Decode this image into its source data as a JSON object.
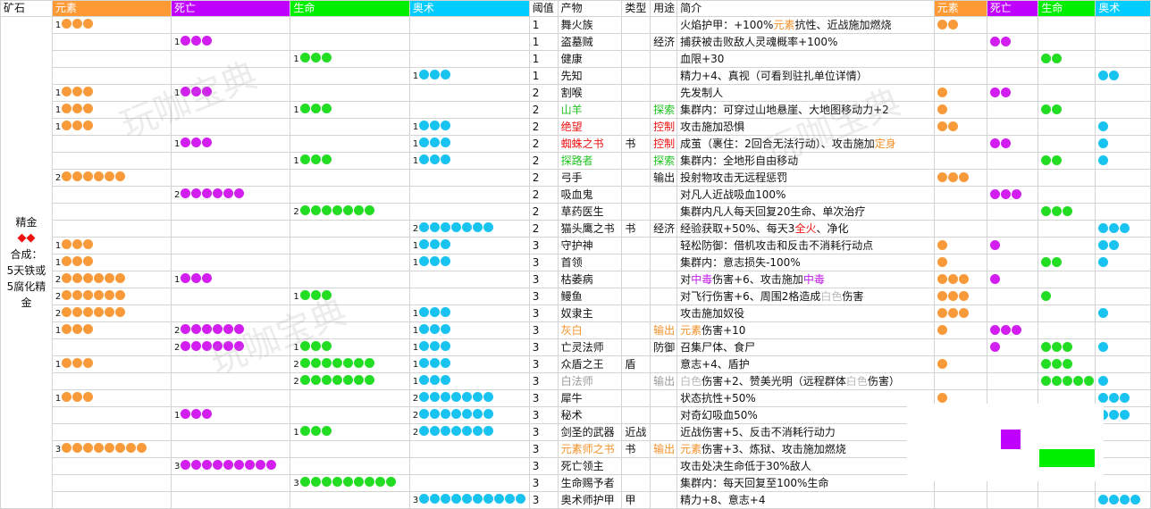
{
  "headers": {
    "ore": "矿石",
    "elem": "元素",
    "death": "死亡",
    "life": "生命",
    "arcane": "奥术",
    "threshold": "阈值",
    "product": "产物",
    "type": "类型",
    "use": "用途",
    "desc": "简介",
    "elem2": "元素",
    "death2": "死亡",
    "life2": "生命",
    "arcane2": "奥术"
  },
  "colors": {
    "elem": "#f99a3a",
    "death": "#d21ff0",
    "life": "#22dd22",
    "arcane": "#19c3f0",
    "elem_header_bg": "#ff9933",
    "death_header_bg": "#c000ff",
    "life_header_bg": "#00ee00",
    "arcane_header_bg": "#00ccff"
  },
  "ore": {
    "name": "精金",
    "diamonds": "◆◆",
    "recipe_label": "合成：",
    "recipe_1": "5天铁或",
    "recipe_2": "5腐化精",
    "recipe_3": "金"
  },
  "watermarks": [
    "玩咖宝典",
    "玩咖宝典",
    "玩咖宝典"
  ],
  "rows": [
    {
      "elem": 1,
      "death": 0,
      "life": 0,
      "arcane": 0,
      "threshold": "1",
      "product": "舞火族",
      "type": "",
      "use": "",
      "desc": [
        {
          "t": "火焰护甲：+100%"
        },
        {
          "t": "元素",
          "c": "t-orange"
        },
        {
          "t": "抗性、近战施加燃烧"
        }
      ],
      "r": [
        2,
        0,
        0,
        0
      ]
    },
    {
      "elem": 0,
      "death": 1,
      "life": 0,
      "arcane": 0,
      "threshold": "1",
      "product": "盗墓贼",
      "type": "",
      "use": "经济",
      "desc": [
        {
          "t": "捕获被击败敌人灵魂概率+100%"
        }
      ],
      "r": [
        0,
        2,
        0,
        0
      ]
    },
    {
      "elem": 0,
      "death": 0,
      "life": 1,
      "arcane": 0,
      "threshold": "1",
      "product": "健康",
      "type": "",
      "use": "",
      "desc": [
        {
          "t": "血限+30"
        }
      ],
      "r": [
        0,
        0,
        2,
        0
      ]
    },
    {
      "elem": 0,
      "death": 0,
      "life": 0,
      "arcane": 1,
      "threshold": "1",
      "product": "先知",
      "type": "",
      "use": "",
      "desc": [
        {
          "t": "精力+4、真视（可看到驻扎单位详情）"
        }
      ],
      "r": [
        0,
        0,
        0,
        2
      ]
    },
    {
      "elem": 1,
      "death": 1,
      "life": 0,
      "arcane": 0,
      "threshold": "2",
      "product": "割喉",
      "type": "",
      "use": "",
      "desc": [
        {
          "t": "先发制人"
        }
      ],
      "r": [
        1,
        2,
        0,
        0
      ]
    },
    {
      "elem": 1,
      "death": 0,
      "life": 1,
      "arcane": 0,
      "threshold": "2",
      "product": "山羊",
      "pc": "t-green",
      "type": "",
      "use": "探索",
      "uc": "t-green",
      "desc": [
        {
          "t": "集群内：可穿过山地悬崖、大地图移动力+2"
        }
      ],
      "r": [
        1,
        0,
        2,
        0
      ]
    },
    {
      "elem": 1,
      "death": 0,
      "life": 0,
      "arcane": 1,
      "threshold": "2",
      "product": "绝望",
      "pc": "t-red",
      "type": "",
      "use": "控制",
      "uc": "t-red",
      "desc": [
        {
          "t": "攻击施加恐惧"
        }
      ],
      "r": [
        2,
        0,
        0,
        1
      ]
    },
    {
      "elem": 0,
      "death": 1,
      "life": 0,
      "arcane": 1,
      "threshold": "2",
      "product": "蜘蛛之书",
      "pc": "t-red",
      "type": "书",
      "use": "控制",
      "uc": "t-red",
      "desc": [
        {
          "t": "成茧（裹住：2回合无法行动）、攻击施加"
        },
        {
          "t": "定身",
          "c": "t-orange"
        }
      ],
      "r": [
        0,
        2,
        0,
        1
      ]
    },
    {
      "elem": 0,
      "death": 0,
      "life": 1,
      "arcane": 1,
      "threshold": "2",
      "product": "探路者",
      "pc": "t-green",
      "type": "",
      "use": "探索",
      "uc": "t-green",
      "desc": [
        {
          "t": "集群内：全地形自由移动"
        }
      ],
      "r": [
        0,
        0,
        2,
        1
      ]
    },
    {
      "elem": 2,
      "death": 0,
      "life": 0,
      "arcane": 0,
      "threshold": "2",
      "product": "弓手",
      "type": "",
      "use": "输出",
      "desc": [
        {
          "t": "投射物攻击无远程惩罚"
        }
      ],
      "r": [
        3,
        0,
        0,
        0
      ]
    },
    {
      "elem": 0,
      "death": 2,
      "life": 0,
      "arcane": 0,
      "threshold": "2",
      "product": "吸血鬼",
      "type": "",
      "use": "",
      "desc": [
        {
          "t": "对凡人近战吸血100%"
        }
      ],
      "r": [
        0,
        3,
        0,
        0
      ]
    },
    {
      "elem": 0,
      "death": 0,
      "life": 2,
      "arcane": 0,
      "threshold": "2",
      "product": "草药医生",
      "type": "",
      "use": "",
      "desc": [
        {
          "t": "集群内凡人每天回复20生命、单次治疗"
        }
      ],
      "r": [
        0,
        0,
        3,
        0
      ]
    },
    {
      "elem": 0,
      "death": 0,
      "life": 0,
      "arcane": 2,
      "threshold": "2",
      "product": "猫头鹰之书",
      "type": "书",
      "use": "经济",
      "desc": [
        {
          "t": "经验获取+50%、每天3"
        },
        {
          "t": "全火",
          "c": "t-red"
        },
        {
          "t": "、净化"
        }
      ],
      "r": [
        0,
        0,
        0,
        3
      ]
    },
    {
      "elem": 1,
      "death": 0,
      "life": 0,
      "arcane": 1,
      "threshold": "3",
      "product": "守护神",
      "type": "",
      "use": "",
      "desc": [
        {
          "t": "轻松防御：借机攻击和反击不消耗行动点"
        }
      ],
      "r": [
        1,
        1,
        0,
        2
      ]
    },
    {
      "elem": 1,
      "death": 0,
      "life": 0,
      "arcane": 1,
      "threshold": "3",
      "product": "首领",
      "type": "",
      "use": "",
      "desc": [
        {
          "t": "集群内：意志损失-100%"
        }
      ],
      "r": [
        1,
        0,
        2,
        1
      ]
    },
    {
      "elem": 2,
      "death": 1,
      "life": 0,
      "arcane": 0,
      "threshold": "3",
      "product": "枯萎病",
      "type": "",
      "use": "",
      "desc": [
        {
          "t": "对"
        },
        {
          "t": "中毒",
          "c": "t-purple"
        },
        {
          "t": "伤害+6、攻击施加"
        },
        {
          "t": "中毒",
          "c": "t-purple"
        }
      ],
      "r": [
        3,
        1,
        0,
        0
      ]
    },
    {
      "elem": 2,
      "death": 0,
      "life": 1,
      "arcane": 0,
      "threshold": "3",
      "product": "鳗鱼",
      "type": "",
      "use": "",
      "desc": [
        {
          "t": "对飞行伤害+6、周围2格造成"
        },
        {
          "t": "白色",
          "c": "t-white"
        },
        {
          "t": "伤害"
        }
      ],
      "r": [
        3,
        0,
        1,
        0
      ]
    },
    {
      "elem": 2,
      "death": 0,
      "life": 0,
      "arcane": 1,
      "threshold": "3",
      "product": "奴隶主",
      "type": "",
      "use": "",
      "desc": [
        {
          "t": "攻击施加奴役"
        }
      ],
      "r": [
        3,
        0,
        0,
        1
      ]
    },
    {
      "elem": 1,
      "death": 2,
      "life": 0,
      "arcane": 1,
      "threshold": "3",
      "product": "灰白",
      "pc": "t-orange",
      "type": "",
      "use": "输出",
      "uc": "t-orange",
      "desc": [
        {
          "t": "元素",
          "c": "t-orange"
        },
        {
          "t": "伤害+10"
        }
      ],
      "r": [
        1,
        3,
        0,
        0
      ]
    },
    {
      "elem": 0,
      "death": 2,
      "life": 1,
      "arcane": 1,
      "threshold": "3",
      "product": "亡灵法师",
      "type": "",
      "use": "防御",
      "desc": [
        {
          "t": "召集尸体、食尸"
        }
      ],
      "r": [
        0,
        1,
        3,
        1
      ]
    },
    {
      "elem": 1,
      "death": 0,
      "life": 2,
      "arcane": 1,
      "threshold": "3",
      "product": "众盾之王",
      "type": "盾",
      "use": "",
      "desc": [
        {
          "t": "意志+4、盾护"
        }
      ],
      "r": [
        1,
        0,
        3,
        0
      ]
    },
    {
      "elem": 0,
      "death": 0,
      "life": 2,
      "arcane": 1,
      "threshold": "3",
      "product": "白法师",
      "pc": "t-gray",
      "type": "",
      "use": "输出",
      "uc": "t-gray",
      "desc": [
        {
          "t": "白色",
          "c": "t-white"
        },
        {
          "t": "伤害+2、赞美光明（远程群体"
        },
        {
          "t": "白色",
          "c": "t-white"
        },
        {
          "t": "伤害）"
        }
      ],
      "r": [
        0,
        0,
        5,
        1
      ]
    },
    {
      "elem": 1,
      "death": 0,
      "life": 0,
      "arcane": 2,
      "threshold": "3",
      "product": "犀牛",
      "type": "",
      "use": "",
      "desc": [
        {
          "t": "状态抗性+50%"
        }
      ],
      "r": [
        1,
        0,
        0,
        3
      ]
    },
    {
      "elem": 0,
      "death": 1,
      "life": 0,
      "arcane": 2,
      "threshold": "3",
      "product": "秘术",
      "type": "",
      "use": "",
      "desc": [
        {
          "t": "对奇幻吸血50%"
        }
      ],
      "r": [
        0,
        1,
        0,
        3
      ]
    },
    {
      "elem": 0,
      "death": 0,
      "life": 1,
      "arcane": 2,
      "threshold": "3",
      "product": "剑圣的武器",
      "type": "近战",
      "use": "",
      "desc": [
        {
          "t": "近战伤害+5、反击不消耗行动力"
        }
      ],
      "r": [
        0,
        0,
        0,
        0
      ]
    },
    {
      "elem": 3,
      "death": 0,
      "life": 0,
      "arcane": 0,
      "threshold": "3",
      "product": "元素师之书",
      "pc": "t-orange",
      "type": "书",
      "use": "输出",
      "uc": "t-orange",
      "desc": [
        {
          "t": "元素",
          "c": "t-orange"
        },
        {
          "t": "伤害+3、炼狱、攻击施加燃烧"
        }
      ],
      "r": [
        0,
        0,
        0,
        0
      ]
    },
    {
      "elem": 0,
      "death": 3,
      "life": 0,
      "arcane": 0,
      "threshold": "3",
      "product": "死亡领主",
      "type": "",
      "use": "",
      "desc": [
        {
          "t": "攻击处决生命低于30%敌人"
        }
      ],
      "r": [
        0,
        0,
        0,
        0
      ]
    },
    {
      "elem": 0,
      "death": 0,
      "life": 3,
      "arcane": 0,
      "threshold": "3",
      "product": "生命赐予者",
      "type": "",
      "use": "",
      "desc": [
        {
          "t": "集群内：每天回复至100%生命"
        }
      ],
      "r": [
        0,
        0,
        0,
        0
      ]
    },
    {
      "elem": 0,
      "death": 0,
      "life": 0,
      "arcane": 3,
      "threshold": "3",
      "product": "奥术师护甲",
      "type": "甲",
      "use": "",
      "desc": [
        {
          "t": "精力+8、意志+4"
        }
      ],
      "r": [
        0,
        0,
        0,
        4
      ]
    }
  ]
}
